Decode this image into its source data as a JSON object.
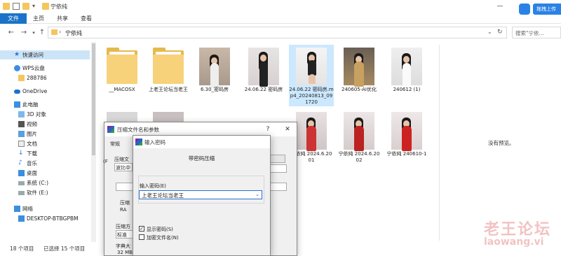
{
  "window": {
    "title": "宁依纯",
    "sync_label": "拖拽上传"
  },
  "ribbon": {
    "tabs": [
      "文件",
      "主页",
      "共享",
      "查看"
    ]
  },
  "address": {
    "path": "宁依纯",
    "search_placeholder": "搜索\"宁依..."
  },
  "sidebar": {
    "items": [
      {
        "label": "快速访问",
        "icon": "star-icon",
        "selected": true
      },
      {
        "label": "WPS云盘",
        "icon": "cloud-icon"
      },
      {
        "label": "288786",
        "icon": "folder-icon"
      },
      {
        "label": "OneDrive",
        "icon": "onedrive-icon"
      },
      {
        "label": "此电脑",
        "icon": "computer-icon"
      },
      {
        "label": "3D 对象",
        "icon": "cube-icon"
      },
      {
        "label": "视频",
        "icon": "video-icon"
      },
      {
        "label": "图片",
        "icon": "picture-icon"
      },
      {
        "label": "文档",
        "icon": "document-icon"
      },
      {
        "label": "下载",
        "icon": "download-icon"
      },
      {
        "label": "音乐",
        "icon": "music-icon"
      },
      {
        "label": "桌面",
        "icon": "desktop-icon"
      },
      {
        "label": "系统 (C:)",
        "icon": "drive-icon"
      },
      {
        "label": "软件 (E:)",
        "icon": "drive-icon"
      },
      {
        "label": "网络",
        "icon": "network-icon"
      },
      {
        "label": "DESKTOP-BTBGPBM",
        "icon": "monitor-icon"
      }
    ]
  },
  "files": [
    {
      "name": "__MACOSX",
      "kind": "folder"
    },
    {
      "name": "上老王论坛当老王",
      "kind": "folder"
    },
    {
      "name": "6.30_密码房",
      "kind": "photo"
    },
    {
      "name": "24.06.22 密码房",
      "kind": "photo"
    },
    {
      "name": "24.06.22 密码房.mp4_20240813_091720",
      "kind": "photo",
      "selected": true
    },
    {
      "name": "240605-AI优化",
      "kind": "photo"
    },
    {
      "name": "240612 (1)",
      "kind": "photo"
    },
    {
      "name": "宁依纯 2024.6.20 01",
      "kind": "photo"
    },
    {
      "name": "宁依纯 2024.6.20 02",
      "kind": "photo"
    },
    {
      "name": "宁依纯 240610-1",
      "kind": "photo"
    }
  ],
  "preview": {
    "text": "没有预览。"
  },
  "status": {
    "count": "18 个项目",
    "selected": "已选择 15 个项目"
  },
  "dialog_archive": {
    "title": "压缩文件名和参数",
    "tab": "常规",
    "labels": [
      "压缩文",
      "波比中",
      "压缩",
      "RA",
      "压缩方",
      "标准",
      "字典大",
      "32 MB",
      "(F"
    ]
  },
  "dialog_password": {
    "title": "输入密码",
    "heading": "带密码压缩",
    "field_label": "输入密码(E)",
    "password_value": "上老王论坛当老王",
    "show_password_label": "显示密码(S)",
    "show_password_checked": true,
    "encrypt_names_label": "加密文件名(N)",
    "encrypt_names_checked": false
  },
  "watermark": {
    "line1": "老王论坛",
    "line2": "laowang.vi"
  },
  "colors": {
    "accent": "#1a73c8",
    "selection": "#cce8ff",
    "sync": "#2b82e5"
  }
}
